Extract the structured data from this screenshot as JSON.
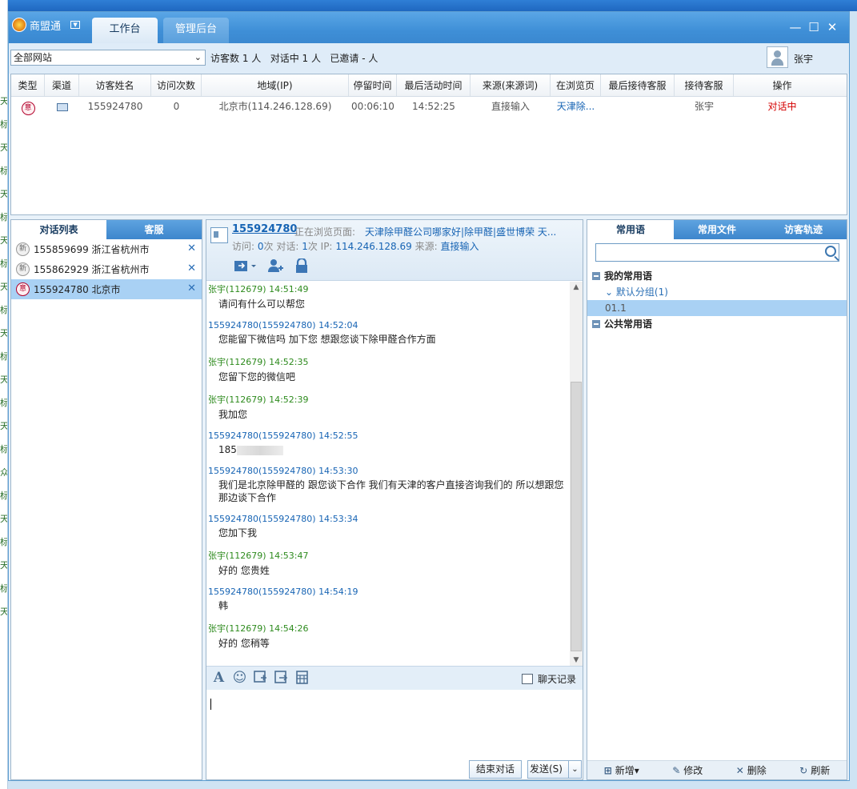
{
  "window": {
    "app_name": "商盟通",
    "tabs": [
      "工作台",
      "管理后台"
    ],
    "controls": [
      "—",
      "☐",
      "✕"
    ]
  },
  "background_glyphs": [
    "天",
    "标",
    "天",
    "标",
    "天",
    "标",
    "天",
    "标",
    "天",
    "标",
    "天",
    "标",
    "天",
    "标",
    "天",
    "标",
    "众",
    "标",
    "天",
    "标",
    "天",
    "标",
    "天"
  ],
  "toolbar": {
    "site_select": "全部网站",
    "stats": "访客数 1 人   对话中 1 人   已邀请 - 人",
    "user_name": "张宇"
  },
  "visitor_table": {
    "headers": [
      "类型",
      "渠道",
      "访客姓名",
      "访问次数",
      "地域(IP)",
      "停留时间",
      "最后活动时间",
      "来源(来源词)",
      "在浏览页",
      "最后接待客服",
      "接待客服",
      "操作"
    ],
    "rows": [
      {
        "type_icon": "意",
        "visitor": "155924780",
        "visits": "0",
        "region": "北京市(114.246.128.69)",
        "stay": "00:06:10",
        "last_active": "14:52:25",
        "source": "直接输入",
        "page": "天津除...",
        "last_agent": "",
        "agent": "张宇",
        "action": "对话中"
      }
    ]
  },
  "left_panel": {
    "tabs": [
      "对话列表",
      "客服"
    ],
    "sessions": [
      {
        "badge": "新",
        "id": "155859699",
        "location": "浙江省杭州市",
        "active": false
      },
      {
        "badge": "新",
        "id": "155862929",
        "location": "浙江省杭州市",
        "active": false
      },
      {
        "badge": "意",
        "id": "155924780",
        "location": "北京市",
        "active": true
      }
    ],
    "close_glyph": "✕"
  },
  "chat": {
    "visitor_id": "155924780",
    "browsing_label": "正在浏览页面:",
    "browsing_page": "天津除甲醛公司哪家好|除甲醛|盛世博荣  天...",
    "visits_label": "访问:",
    "visits_value": "0",
    "visits_unit": "次 对话:",
    "chats_value": "1",
    "ip_label": "次 IP:",
    "ip_value": "114.246.128.69",
    "source_label": "来源:",
    "source_value": "直接输入",
    "messages": [
      {
        "role": "agent",
        "sender": "张宇(112679)",
        "time": "14:51:49",
        "text": "请问有什么可以帮您"
      },
      {
        "role": "visitor",
        "sender": "155924780(155924780)",
        "time": "14:52:04",
        "text": "您能留下微信吗 加下您 想跟您谈下除甲醛合作方面"
      },
      {
        "role": "agent",
        "sender": "张宇(112679)",
        "time": "14:52:35",
        "text": "您留下您的微信吧"
      },
      {
        "role": "agent",
        "sender": "张宇(112679)",
        "time": "14:52:39",
        "text": "我加您"
      },
      {
        "role": "visitor",
        "sender": "155924780(155924780)",
        "time": "14:52:55",
        "text": "185"
      },
      {
        "role": "visitor",
        "sender": "155924780(155924780)",
        "time": "14:53:30",
        "text": "我们是北京除甲醛的 跟您谈下合作 我们有天津的客户直接咨询我们的  所以想跟您那边谈下合作"
      },
      {
        "role": "visitor",
        "sender": "155924780(155924780)",
        "time": "14:53:34",
        "text": "您加下我"
      },
      {
        "role": "agent",
        "sender": "张宇(112679)",
        "time": "14:53:47",
        "text": "好的   您贵姓"
      },
      {
        "role": "visitor",
        "sender": "155924780(155924780)",
        "time": "14:54:19",
        "text": "韩"
      },
      {
        "role": "agent",
        "sender": "张宇(112679)",
        "time": "14:54:26",
        "text": "好的   您稍等"
      }
    ],
    "history_label": "聊天记录",
    "end_button": "结束对话",
    "send_button": "发送(S)",
    "colors": {
      "agent": "#2e8b1e",
      "visitor": "#1764b4"
    }
  },
  "right_panel": {
    "tabs": [
      "常用语",
      "常用文件",
      "访客轨迹"
    ],
    "search_placeholder": "",
    "tree": {
      "my_phrases": "我的常用语",
      "default_group": "默认分组(1)",
      "item": "01.1",
      "public_phrases": "公共常用语"
    },
    "bottom": {
      "add": "新增▾",
      "edit": "修改",
      "delete": "删除",
      "refresh": "刷新"
    }
  }
}
